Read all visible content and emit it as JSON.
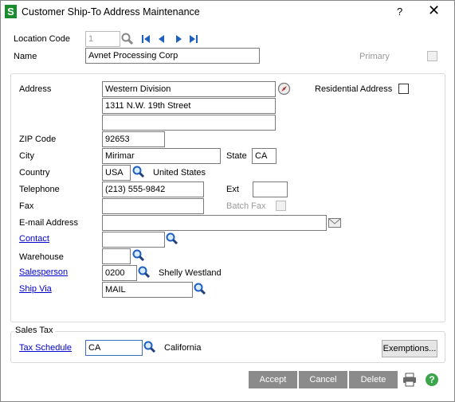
{
  "window": {
    "title": "Customer Ship-To Address Maintenance",
    "help": "?",
    "close": "✕",
    "logo": "S"
  },
  "header": {
    "location_code_label": "Location Code",
    "location_code_value": "1",
    "name_label": "Name",
    "name_value": "Avnet Processing Corp",
    "primary_label": "Primary"
  },
  "address": {
    "address_label": "Address",
    "line1": "Western Division",
    "line2": "1311 N.W. 19th Street",
    "line3": "",
    "residential_label": "Residential Address",
    "zip_label": "ZIP Code",
    "zip_value": "92653",
    "city_label": "City",
    "city_value": "Mirimar",
    "state_label": "State",
    "state_value": "CA",
    "country_label": "Country",
    "country_value": "USA",
    "country_name": "United States",
    "telephone_label": "Telephone",
    "telephone_value": "(213) 555-9842",
    "ext_label": "Ext",
    "ext_value": "",
    "fax_label": "Fax",
    "fax_value": "",
    "batch_fax_label": "Batch Fax",
    "email_label": "E-mail Address",
    "email_value": "",
    "contact_label": "Contact",
    "contact_value": "",
    "warehouse_label": "Warehouse",
    "warehouse_value": "",
    "salesperson_label": "Salesperson",
    "salesperson_value": "0200",
    "salesperson_name": "Shelly Westland",
    "shipvia_label": "Ship Via",
    "shipvia_value": "MAIL"
  },
  "sales_tax": {
    "group_label": "Sales Tax",
    "tax_schedule_label": "Tax Schedule",
    "tax_schedule_value": "CA",
    "tax_schedule_name": "California",
    "exemptions_label": "Exemptions..."
  },
  "footer": {
    "accept": "Accept",
    "cancel": "Cancel",
    "delete": "Delete"
  },
  "icons": {
    "lookup": "magnifier-icon",
    "first": "first-record-icon",
    "prev": "previous-record-icon",
    "next": "next-record-icon",
    "last": "last-record-icon",
    "address_validate": "compass-icon",
    "email": "envelope-icon",
    "print": "printer-icon",
    "help": "help-icon"
  },
  "colors": {
    "logo_green": "#1a8c2e",
    "link_blue": "#0000cc",
    "button_gray": "#8b8b8b",
    "help_green": "#3aa54a"
  }
}
